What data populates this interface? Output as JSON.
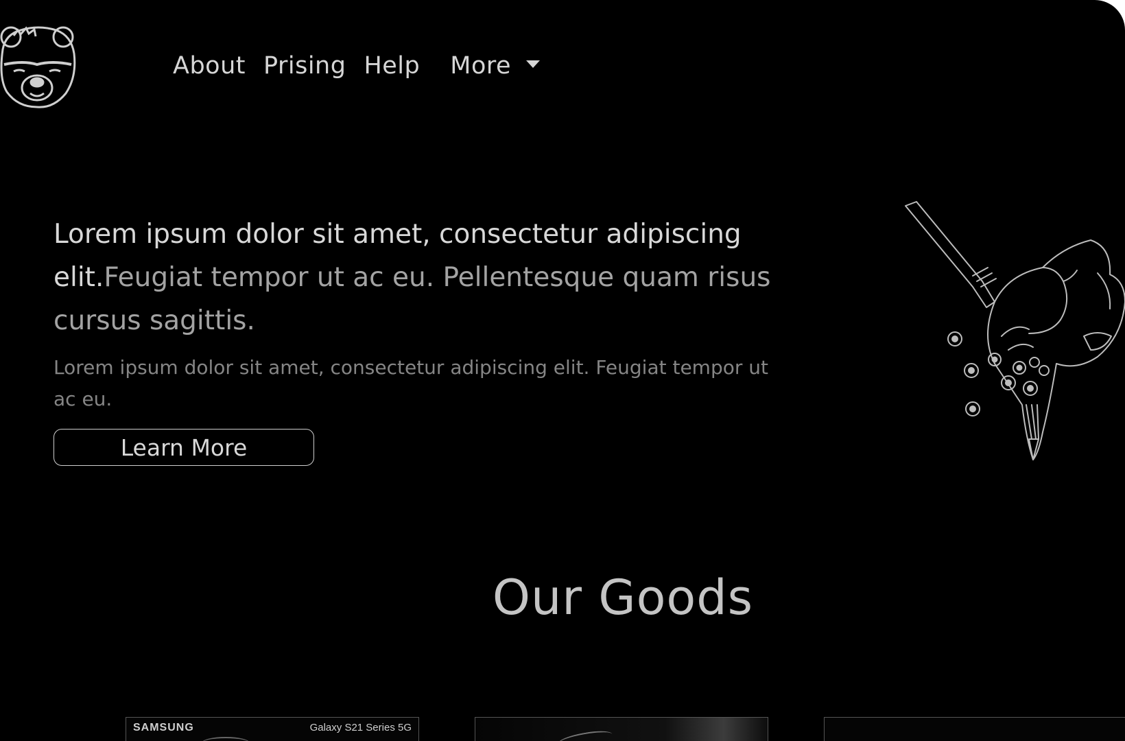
{
  "header": {
    "logo_icon": "bear-logo-icon",
    "nav": [
      {
        "label": "About"
      },
      {
        "label": "Prising"
      },
      {
        "label": "Help"
      }
    ],
    "more_label": "More",
    "more_icon": "caret-down-icon"
  },
  "hero": {
    "title_main": "Lorem ipsum dolor sit amet, consectetur adipiscing elit.",
    "title_muted": "Feugiat tempor ut ac eu. Pellentesque quam risus cursus sagittis.",
    "subtitle": "Lorem ipsum dolor sit amet, consectetur adipiscing elit. Feugiat tempor ut ac eu.",
    "button_label": "Learn More",
    "illustration_icon": "hand-sketch-illustration-icon"
  },
  "goods": {
    "title": "Our Goods",
    "cards": [
      {
        "brand": "SAMSUNG",
        "model": "Galaxy S21 Series 5G"
      },
      {
        "brand": "",
        "model": ""
      },
      {
        "brand": "",
        "model": ""
      }
    ]
  },
  "colors": {
    "background": "#000000",
    "text": "#d8d8d8",
    "muted_text": "#a3a3a3",
    "subtle_text": "#858585"
  }
}
